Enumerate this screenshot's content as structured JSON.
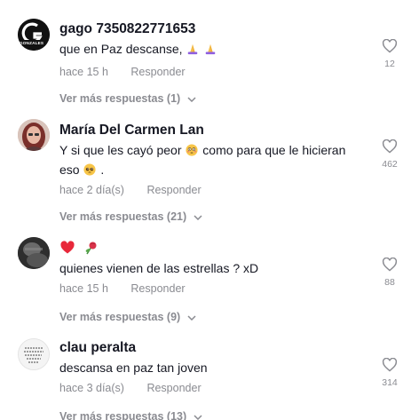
{
  "comments": [
    {
      "username": "gago 7350822771653",
      "text": "que en Paz descanse,",
      "time": "hace 15 h",
      "reply_label": "Responder",
      "likes": "12",
      "more_replies": "Ver más respuestas (1)",
      "avatar_text": "GONZALES"
    },
    {
      "username": "María Del Carmen Lan",
      "text_line1": "Y si que les cayó peor",
      "text_line1b": "como para que le hicieran",
      "text_line2": "eso",
      "time": "hace 2 día(s)",
      "reply_label": "Responder",
      "likes": "462",
      "more_replies": "Ver más respuestas (21)"
    },
    {
      "username": "",
      "text": "quienes vienen de las estrellas ? xD",
      "time": "hace 15 h",
      "reply_label": "Responder",
      "likes": "88",
      "more_replies": "Ver más respuestas (9)"
    },
    {
      "username": "clau peralta",
      "text": "descansa en paz tan joven",
      "time": "hace 3 día(s)",
      "reply_label": "Responder",
      "likes": "314",
      "more_replies": "Ver más respuestas (13)"
    }
  ],
  "colors": {
    "text": "#161823",
    "muted": "#8a8b91",
    "heart_red": "#e8283a"
  },
  "icons": {
    "like": "heart-outline-icon",
    "expand": "chevron-down-icon",
    "pray": "praying-hands-emoji",
    "flushed": "flushed-face-emoji",
    "pleading": "pleading-face-emoji",
    "heart": "red-heart-emoji",
    "rose": "wilted-rose-emoji"
  }
}
